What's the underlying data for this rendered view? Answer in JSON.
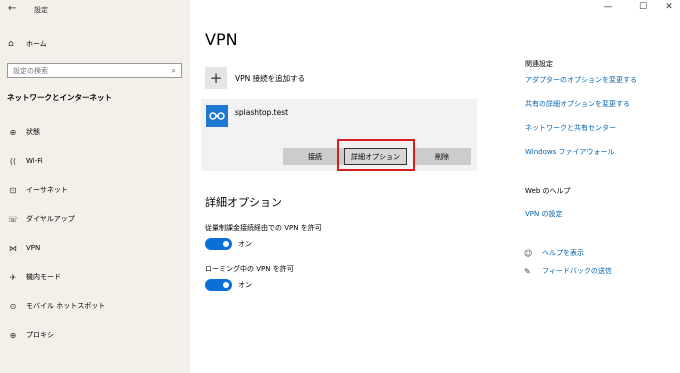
{
  "window": {
    "title": "設定",
    "controls": {
      "minimize": "—",
      "maximize": "☐",
      "close": "✕"
    }
  },
  "sidebar": {
    "back_icon": "←",
    "home": {
      "icon": "⌂",
      "label": "ホーム"
    },
    "search": {
      "placeholder": "設定の検索",
      "icon": "⌕"
    },
    "section_title": "ネットワークとインターネット",
    "items": [
      {
        "icon": "⊕",
        "label": "状態"
      },
      {
        "icon": "((",
        "label": "Wi-Fi"
      },
      {
        "icon": "⊡",
        "label": "イーサネット"
      },
      {
        "icon": "☏",
        "label": "ダイヤルアップ"
      },
      {
        "icon": "⋈",
        "label": "VPN"
      },
      {
        "icon": "✈",
        "label": "機内モード"
      },
      {
        "icon": "⊙",
        "label": "モバイル ホットスポット"
      },
      {
        "icon": "⊕",
        "label": "プロキシ"
      }
    ]
  },
  "main": {
    "title": "VPN",
    "add_vpn": {
      "icon": "+",
      "label": "VPN 接続を追加する"
    },
    "connection": {
      "name": "splashtop.test",
      "buttons": {
        "connect": "接続",
        "advanced": "詳細オプション",
        "delete": "削除"
      }
    },
    "advanced": {
      "title": "詳細オプション",
      "options": [
        {
          "label": "従量制課金接続経由での VPN を許可",
          "state": "オン"
        },
        {
          "label": "ローミング中の VPN を許可",
          "state": "オン"
        }
      ]
    }
  },
  "related": {
    "heading": "関連設定",
    "links": [
      "アダプターのオプションを変更する",
      "共有の詳細オプションを変更する",
      "ネットワークと共有センター",
      "Windows ファイアウォール"
    ],
    "web_help_heading": "Web のヘルプ",
    "web_help_link": "VPN の設定",
    "help": {
      "icon": "☺",
      "label": "ヘルプを表示"
    },
    "feedback": {
      "icon": "✎",
      "label": "フィードバックの送信"
    }
  },
  "colors": {
    "accent": "#0a6fd6",
    "link": "#0063b1",
    "highlight": "#d81e1e",
    "sidebar_bg": "#f2f0e8"
  }
}
